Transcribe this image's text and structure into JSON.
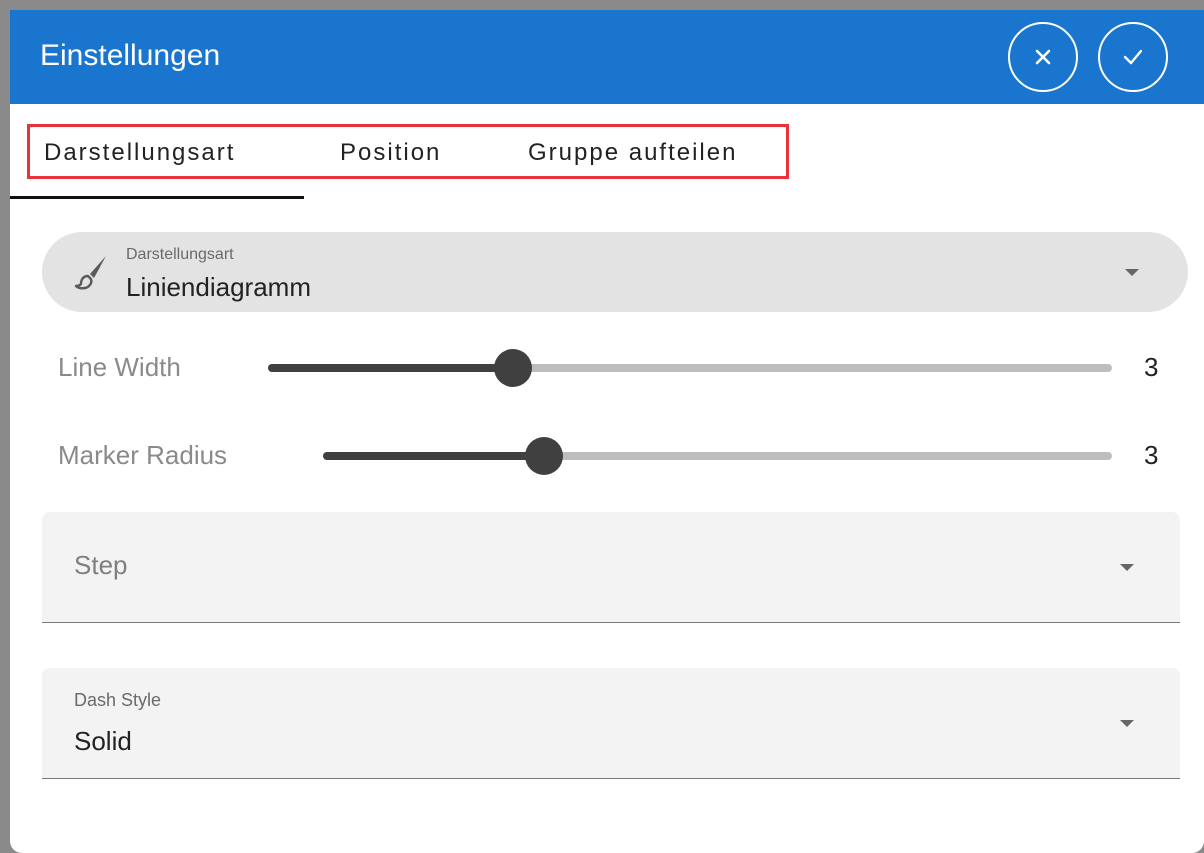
{
  "dialog": {
    "title": "Einstellungen",
    "close_icon": "close-icon",
    "confirm_icon": "check-icon",
    "accent_color": "#1a75cf"
  },
  "tabs": [
    {
      "label": "Darstellungsart",
      "active": true
    },
    {
      "label": "Position",
      "active": false
    },
    {
      "label": "Gruppe aufteilen",
      "active": false
    }
  ],
  "display_type": {
    "icon": "brush-icon",
    "label": "Darstellungsart",
    "value": "Liniendiagramm"
  },
  "sliders": [
    {
      "label": "Line Width",
      "value": "3",
      "fraction": 0.29
    },
    {
      "label": "Marker Radius",
      "value": "3",
      "fraction": 0.28
    }
  ],
  "step_field": {
    "placeholder": "Step",
    "value": ""
  },
  "dash_style_field": {
    "label": "Dash Style",
    "value": "Solid"
  }
}
